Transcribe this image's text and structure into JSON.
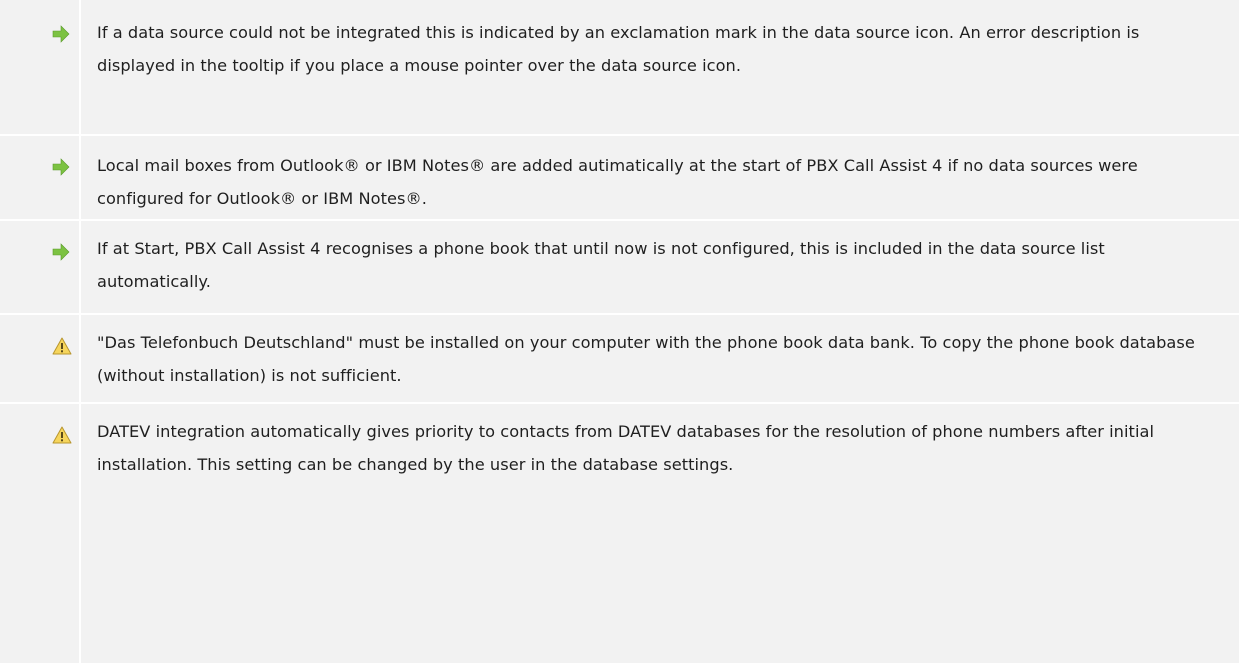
{
  "notes": [
    {
      "type": "tip",
      "icon": "arrow-right-icon",
      "text": "If a data source could not be integrated this is indicated by an exclamation mark in the data source icon. An error description is displayed in the tooltip if you place a mouse pointer over the data source icon."
    },
    {
      "type": "tip",
      "icon": "arrow-right-icon",
      "text": "Local mail boxes from Outlook® or IBM Notes® are added autimatically at the start of PBX Call Assist 4 if no data sources were configured for Outlook® or IBM Notes®."
    },
    {
      "type": "tip",
      "icon": "arrow-right-icon",
      "text": "If at Start, PBX Call Assist 4 recognises a phone book that until now is not configured, this is included in the data source list automatically."
    },
    {
      "type": "warning",
      "icon": "warning-icon",
      "text": "\"Das Telefonbuch Deutschland\" must be installed on your computer with the phone book data bank. To copy the phone book database (without installation) is not sufficient."
    },
    {
      "type": "warning",
      "icon": "warning-icon",
      "text": "DATEV integration automatically gives priority to contacts from DATEV databases for the resolution of phone numbers after initial installation. This setting can be changed by the user in the database settings."
    }
  ],
  "colors": {
    "row_background": "#f2f2f2",
    "tip_arrow": "#7cc242",
    "warning_fill": "#f6d55c",
    "warning_stroke": "#b8962e",
    "text": "#1f1f1f"
  }
}
